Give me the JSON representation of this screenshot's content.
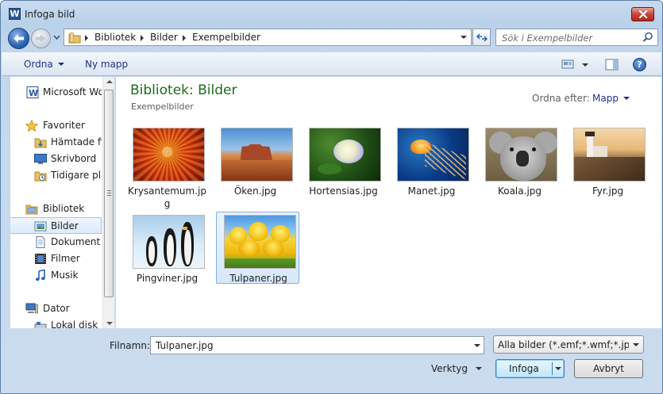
{
  "window": {
    "title": "Infoga bild",
    "app_icon_letter": "W"
  },
  "address": {
    "crumbs": [
      "Bibliotek",
      "Bilder",
      "Exempelbilder"
    ],
    "search_placeholder": "Sök i Exempelbilder"
  },
  "toolbar": {
    "organize": "Ordna",
    "new_folder": "Ny mapp"
  },
  "nav": {
    "items": [
      {
        "label": "Microsoft Wo",
        "icon": "word-doc-icon"
      },
      {
        "label": "Favoriter",
        "icon": "star-icon"
      },
      {
        "label": "Hämtade fil",
        "icon": "downloads-folder-icon"
      },
      {
        "label": "Skrivbord",
        "icon": "desktop-icon"
      },
      {
        "label": "Tidigare pla",
        "icon": "recent-places-icon"
      },
      {
        "label": "Bibliotek",
        "icon": "libraries-icon"
      },
      {
        "label": "Bilder",
        "icon": "pictures-icon",
        "selected": true
      },
      {
        "label": "Dokument",
        "icon": "documents-icon"
      },
      {
        "label": "Filmer",
        "icon": "videos-icon"
      },
      {
        "label": "Musik",
        "icon": "music-icon"
      },
      {
        "label": "Dator",
        "icon": "computer-icon"
      },
      {
        "label": "Lokal disk (C",
        "icon": "local-disk-icon"
      }
    ]
  },
  "content": {
    "library_title": "Bibliotek: Bilder",
    "library_subtitle": "Exempelbilder",
    "arrange_label": "Ordna efter:",
    "arrange_value": "Mapp",
    "files": [
      {
        "name": "Krysantemum.jpg",
        "name_line1": "Krysantemum.jp",
        "name_line2": "g"
      },
      {
        "name": "Öken.jpg"
      },
      {
        "name": "Hortensias.jpg"
      },
      {
        "name": "Manet.jpg"
      },
      {
        "name": "Koala.jpg"
      },
      {
        "name": "Fyr.jpg"
      },
      {
        "name": "Pingviner.jpg"
      },
      {
        "name": "Tulpaner.jpg",
        "selected": true
      }
    ]
  },
  "bottom": {
    "filename_label": "Filnamn:",
    "filename_value": "Tulpaner.jpg",
    "filter_value": "Alla bilder (*.emf;*.wmf;*.jpg;*.",
    "tools_label": "Verktyg",
    "insert_label": "Infoga",
    "cancel_label": "Avbryt"
  },
  "colors": {
    "library_title": "#1e6b1e",
    "link": "#1e3287",
    "selection": "#d7e8fc"
  }
}
